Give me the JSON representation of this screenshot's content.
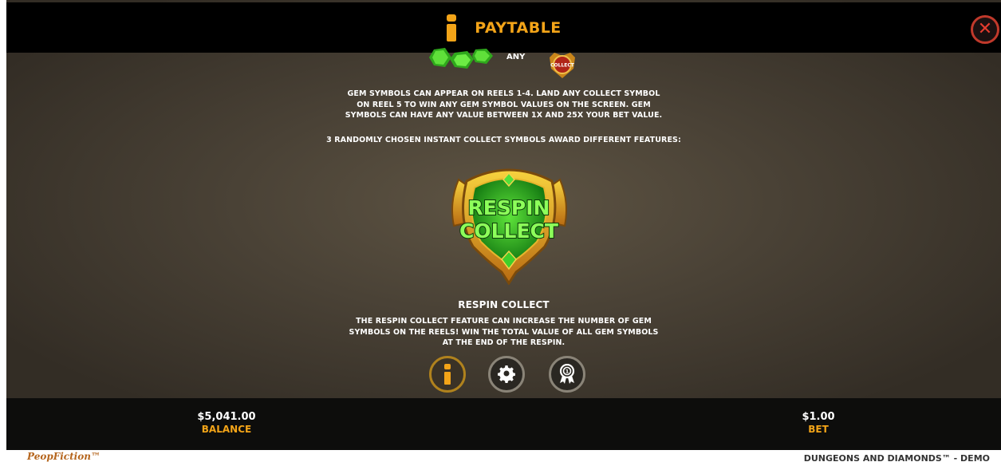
{
  "header": {
    "title": "PAYTABLE",
    "close_icon": "close-icon"
  },
  "paytable": {
    "any_label": "ANY",
    "collect_badge_label": "COLLECT",
    "gem_description": "GEM SYMBOLS CAN APPEAR ON REELS 1-4. LAND ANY COLLECT SYMBOL ON REEL 5 TO WIN ANY GEM SYMBOL VALUES ON THE SCREEN. GEM SYMBOLS CAN HAVE ANY VALUE BETWEEN 1X AND 25X YOUR BET VALUE.",
    "instant_collect_text": "3 RANDOMLY CHOSEN INSTANT COLLECT SYMBOLS AWARD DIFFERENT FEATURES:",
    "feature": {
      "badge_line1": "RESPIN",
      "badge_line2": "COLLECT",
      "title": "RESPIN COLLECT",
      "description": "THE RESPIN COLLECT FEATURE CAN INCREASE THE NUMBER OF GEM SYMBOLS ON THE REELS! WIN THE TOTAL VALUE OF ALL GEM SYMBOLS AT THE END OF THE RESPIN."
    }
  },
  "nav": {
    "info_icon": "info-icon",
    "settings_icon": "gear-icon",
    "rules_icon": "award-ribbon-icon"
  },
  "status": {
    "balance_value": "$5,041.00",
    "balance_label": "BALANCE",
    "bet_value": "$1.00",
    "bet_label": "BET"
  },
  "footer": {
    "brand": "PeopFiction™",
    "game_name": "DUNGEONS AND DIAMONDS™ - DEMO"
  },
  "colors": {
    "accent": "#f3a418",
    "close_red": "#e33b2e",
    "gem_green": "#3fcf2a",
    "gold": "#d9a21c"
  }
}
